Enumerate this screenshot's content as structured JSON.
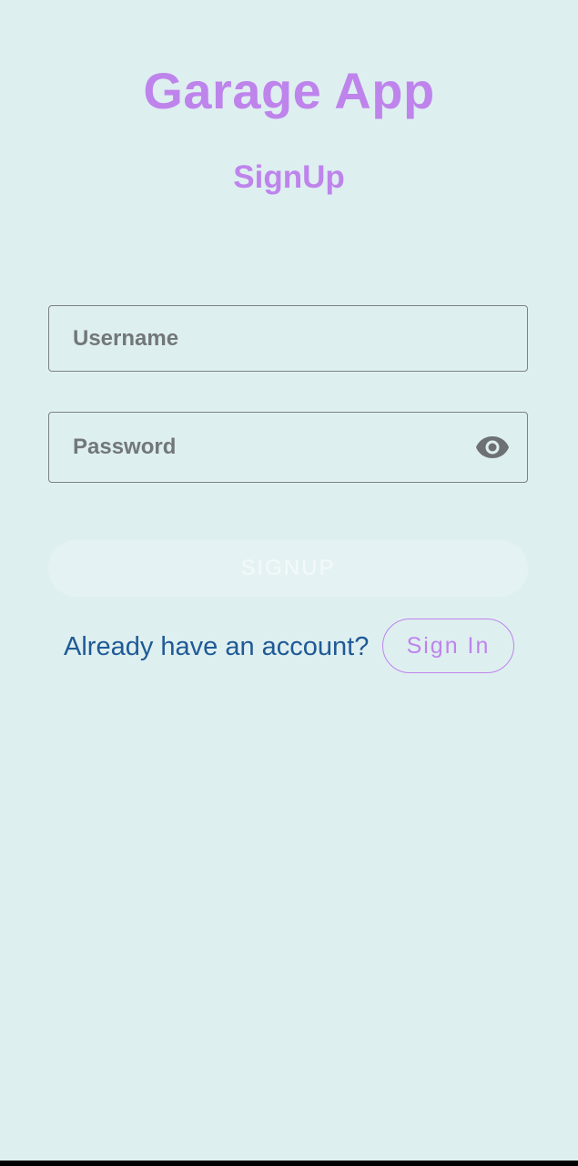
{
  "app": {
    "title": "Garage App",
    "subtitle": "SignUp"
  },
  "form": {
    "username": {
      "label": "Username",
      "value": ""
    },
    "password": {
      "label": "Password",
      "value": "",
      "toggle_icon": "eye-icon"
    },
    "submit_label": "SIGNUP",
    "submit_enabled": false
  },
  "footer": {
    "prompt": "Already have an account?",
    "signin_label": "Sign In"
  },
  "colors": {
    "background": "#deeff0",
    "accent": "#be84ec",
    "link_text": "#1f5a96",
    "field_border": "#7d8285"
  }
}
